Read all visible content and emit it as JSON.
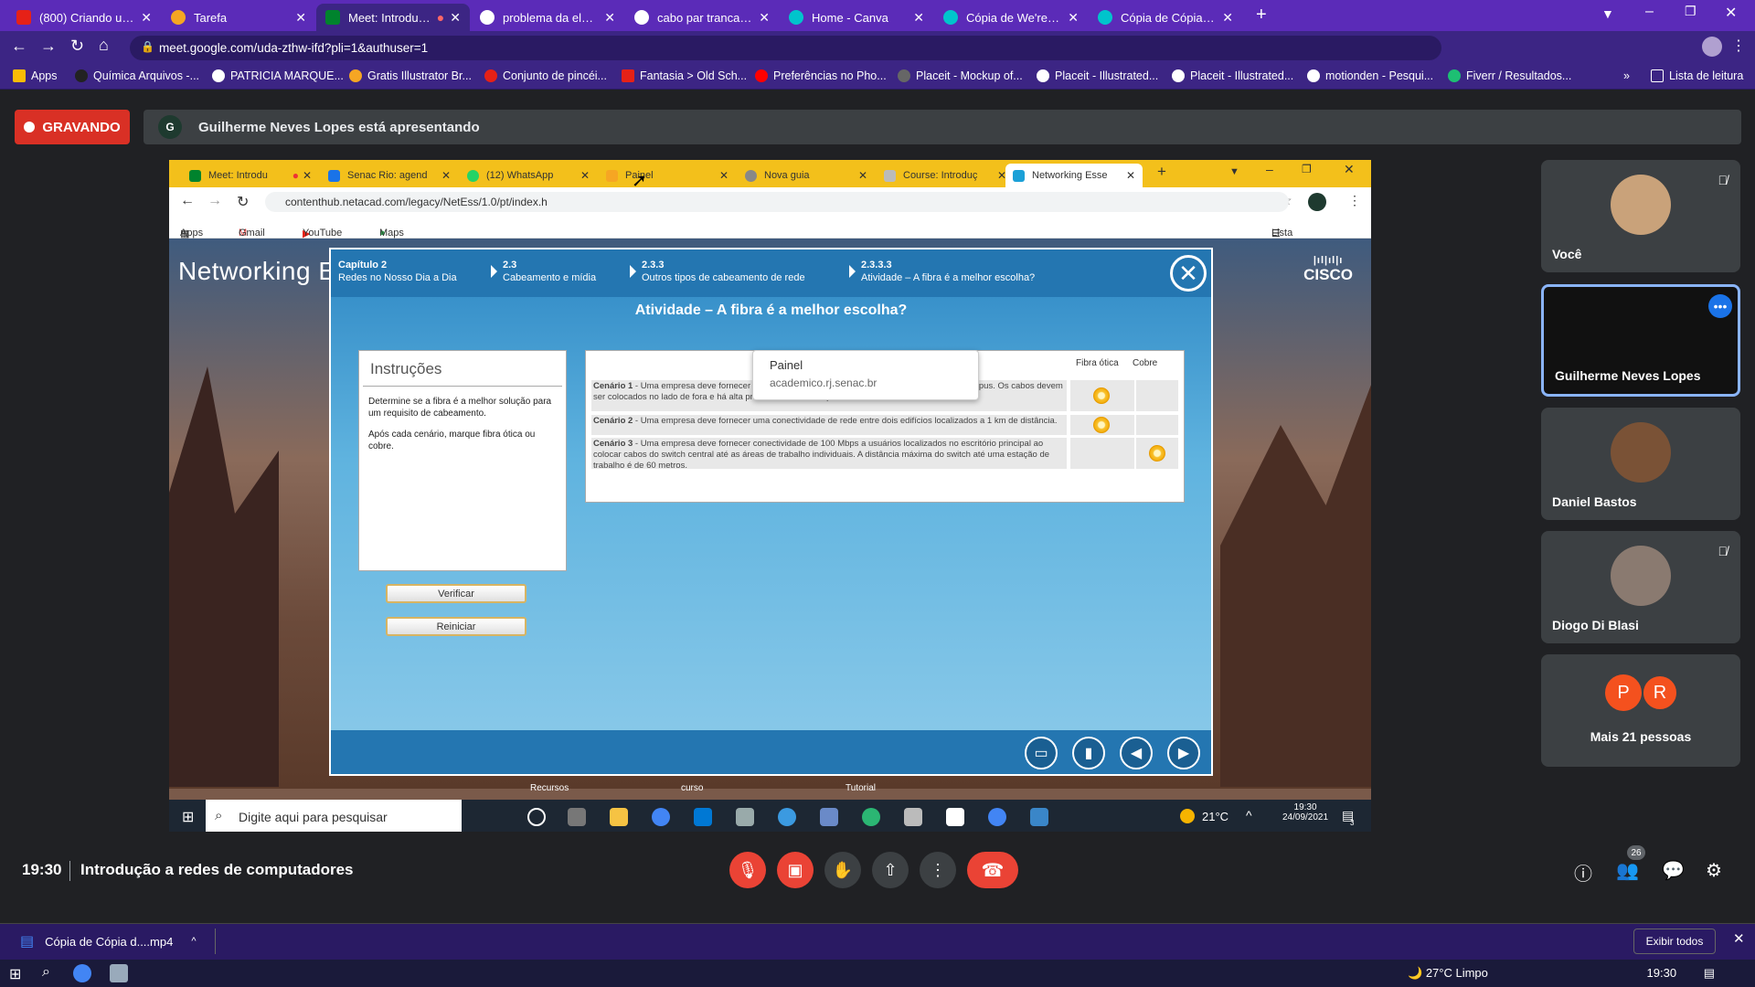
{
  "outer_tabs": [
    {
      "label": "(800) Criando um site do z",
      "fav": "#e62117"
    },
    {
      "label": "Tarefa",
      "fav": "#f6a623"
    },
    {
      "label": "Meet: Introdução a re",
      "fav": "#00832d"
    },
    {
      "label": "problema da eletricidade s",
      "fav": "#4285f4"
    },
    {
      "label": "cabo par trancado - Pesqu",
      "fav": "#4285f4"
    },
    {
      "label": "Home - Canva",
      "fav": "#00c4cc"
    },
    {
      "label": "Cópia de We're Hiring link",
      "fav": "#00c4cc"
    },
    {
      "label": "Cópia de Cópia de Cópia d",
      "fav": "#00c4cc"
    }
  ],
  "outer_url": "meet.google.com/uda-zthw-ifd?pli=1&authuser=1",
  "bookmarks": [
    "Apps",
    "Química Arquivos -...",
    "PATRICIA MARQUE...",
    "Gratis Illustrator Br...",
    "Conjunto de pincéi...",
    "Fantasia > Old Sch...",
    "Preferências no Pho...",
    "Placeit - Mockup of...",
    "Placeit - Illustrated...",
    "Placeit - Illustrated...",
    "motionden - Pesqui...",
    "Fiverr / Resultados..."
  ],
  "reading_list": "Lista de leitura",
  "recording": "GRAVANDO",
  "presenter": {
    "initial": "G",
    "text": "Guilherme Neves Lopes está apresentando"
  },
  "inner": {
    "tabs": [
      "Meet: Introdu",
      "Senac Rio: agend",
      "(12) WhatsApp",
      "Painel",
      "Nova guia",
      "Course: Introduç",
      "Networking Esse"
    ],
    "url": "contenthub.netacad.com/legacy/NetEss/1.0/pt/index.h",
    "bookmarks": [
      "Apps",
      "Gmail",
      "YouTube",
      "Maps"
    ],
    "reading_list": "Lista de leitura",
    "tooltip": {
      "title": "Painel",
      "url": "academico.rj.senac.br"
    },
    "bg_title": "Networking E",
    "cisco": "CISCO",
    "breadcrumbs": [
      {
        "a": "Capítulo 2",
        "b": "Redes no Nosso Dia a Dia"
      },
      {
        "a": "2.3",
        "b": "Cabeamento e mídia"
      },
      {
        "a": "2.3.3",
        "b": "Outros tipos de cabeamento de rede"
      },
      {
        "a": "2.3.3.3",
        "b": "Atividade – A fibra é a melhor escolha?"
      }
    ],
    "activity_title": "Atividade – A fibra é a melhor escolha?",
    "instructions_title": "Instruções",
    "instructions_p1": "Determine se a fibra é a melhor solução para um requisito de cabeamento.",
    "instructions_p2": "Após cada cenário, marque fibra ótica ou cobre.",
    "col_fibra": "Fibra ótica",
    "col_cobre": "Cobre",
    "scenarios": [
      {
        "label": "Cenário 1",
        "text": " - Uma empresa deve fornecer conectividade de rede entre três prédios em um único campus. Os cabos devem ser colocados no lado de fora e há alta probabilidade de tempestades na área.",
        "answer": "fibra"
      },
      {
        "label": "Cenário 2",
        "text": " - Uma empresa deve fornecer uma conectividade de rede entre dois edifícios localizados a 1 km de distância.",
        "answer": "fibra"
      },
      {
        "label": "Cenário 3",
        "text": " - Uma empresa deve fornecer conectividade de 100 Mbps a usuários localizados no escritório principal ao colocar cabos do switch central até as áreas de trabalho individuais. A distância máxima do switch até uma estação de trabalho é de 60 metros.",
        "answer": "cobre"
      }
    ],
    "btn_verify": "Verificar",
    "btn_reset": "Reiniciar",
    "behind_labels": [
      "Recursos",
      "curso",
      "Tutorial"
    ],
    "search_placeholder": "Digite aqui para pesquisar",
    "weather": "21°C",
    "clock_time": "19:30",
    "clock_date": "24/09/2021",
    "notif_count": "3"
  },
  "participants": [
    {
      "name": "Você",
      "muted": true,
      "color": "#c9a27a"
    },
    {
      "name": "Guilherme Neves Lopes",
      "muted": false,
      "color": "#111"
    },
    {
      "name": "Daniel Bastos",
      "muted": false,
      "color": "#7a5236"
    },
    {
      "name": "Diogo Di Blasi",
      "muted": true,
      "color": "#8a7a70"
    }
  ],
  "more_people": {
    "text": "Mais 21 pessoas",
    "avatars": [
      "P",
      "R"
    ]
  },
  "meeting": {
    "time": "19:30",
    "title": "Introdução a redes de computadores",
    "people_count": "26"
  },
  "download": {
    "file": "Cópia de Cópia d....mp4",
    "show_all": "Exibir todos"
  },
  "taskbar": {
    "weather": "27°C Limpo",
    "time": "19:30"
  }
}
